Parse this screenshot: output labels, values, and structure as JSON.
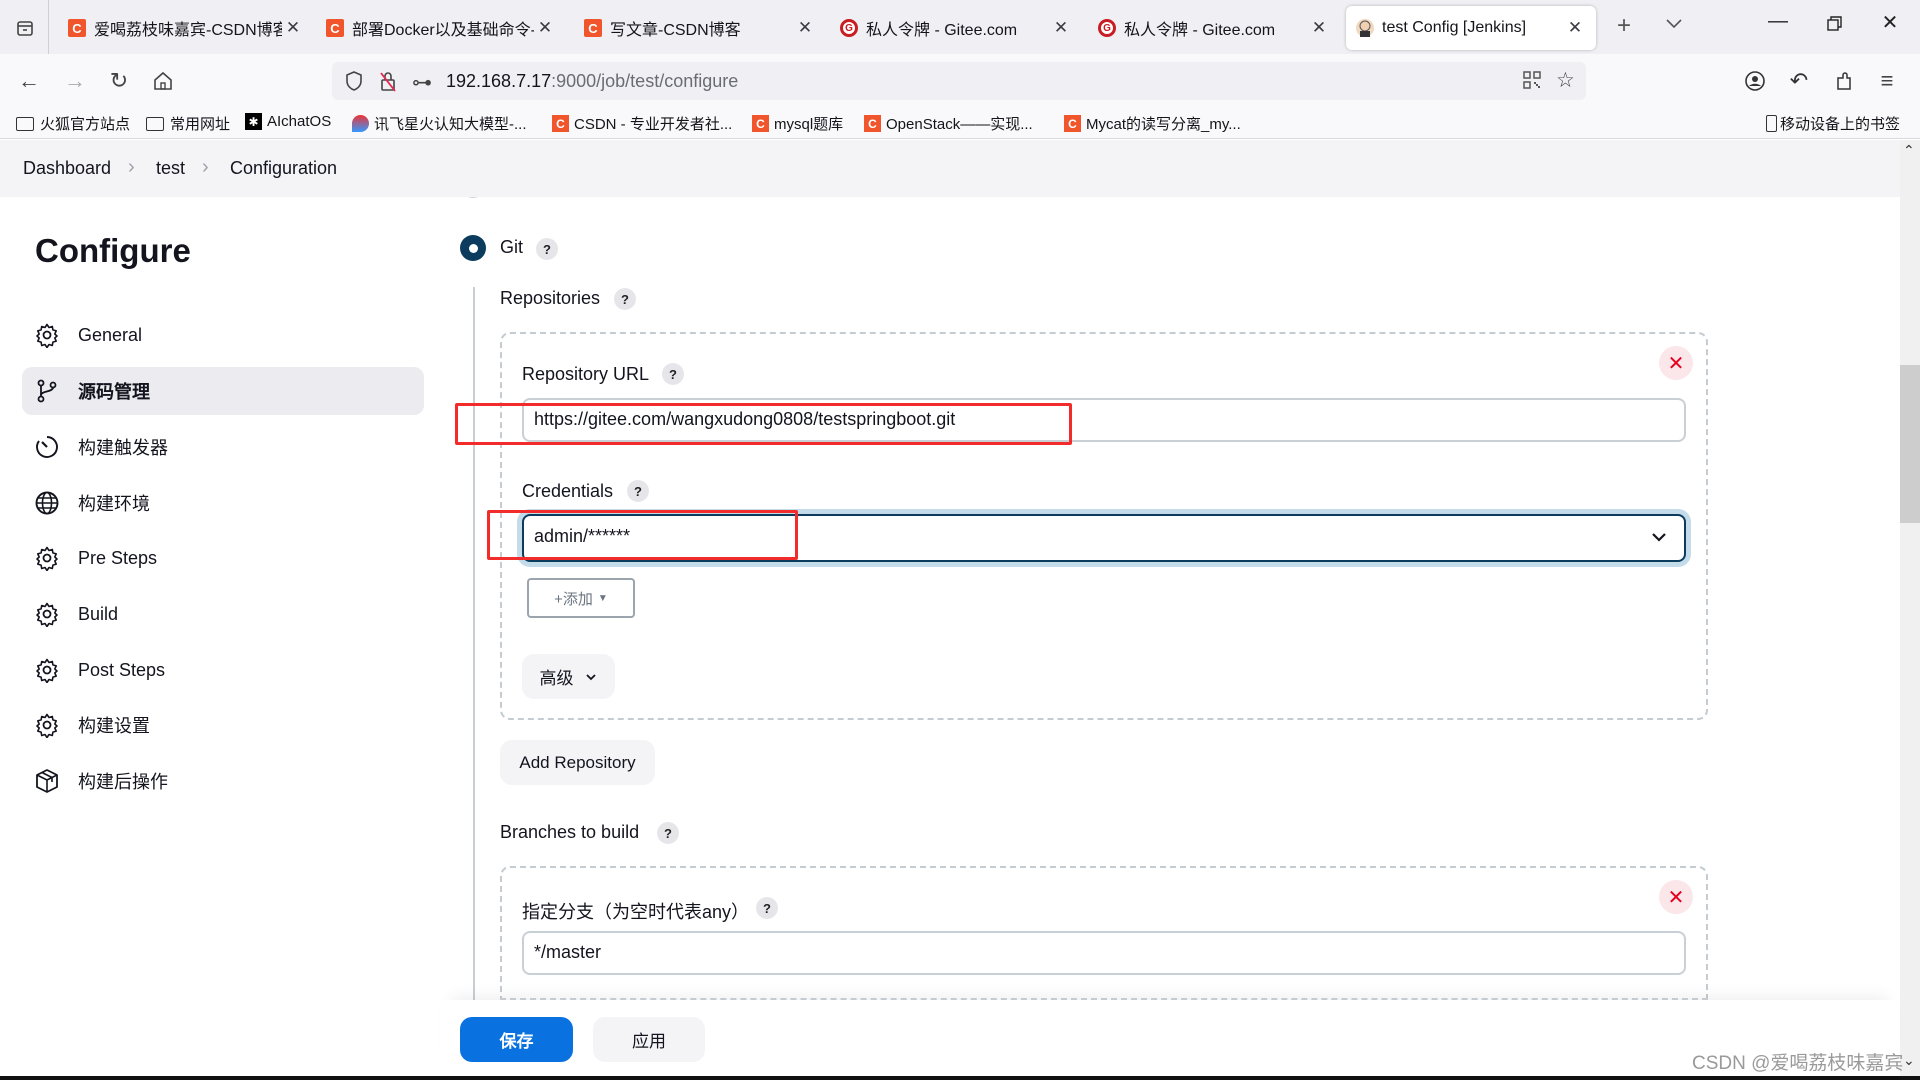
{
  "browser": {
    "tabs": [
      {
        "title": "爱喝荔枝味嘉宾-CSDN博客",
        "icon": "csdn-icon",
        "active": false
      },
      {
        "title": "部署Docker以及基础命令-CSDN",
        "icon": "csdn-icon",
        "active": false
      },
      {
        "title": "写文章-CSDN博客",
        "icon": "csdn-icon",
        "active": false
      },
      {
        "title": "私人令牌 - Gitee.com",
        "icon": "gitee-icon",
        "active": false
      },
      {
        "title": "私人令牌 - Gitee.com",
        "icon": "gitee-icon",
        "active": false
      },
      {
        "title": "test Config [Jenkins]",
        "icon": "jenkins-icon",
        "active": true
      }
    ],
    "url_host": "192.168.7.17",
    "url_rest": ":9000/job/test/configure",
    "bookmarks": [
      {
        "label": "火狐官方站点",
        "icon": "folder-icon"
      },
      {
        "label": "常用网址",
        "icon": "folder-icon"
      },
      {
        "label": "AIchatOS",
        "icon": "openai-icon"
      },
      {
        "label": "讯飞星火认知大模型-...",
        "icon": "spark-icon"
      },
      {
        "label": "CSDN - 专业开发者社...",
        "icon": "csdn-icon"
      },
      {
        "label": "mysql题库",
        "icon": "csdn-icon"
      },
      {
        "label": "OpenStack——实现...",
        "icon": "csdn-icon"
      },
      {
        "label": "Mycat的读写分离_my...",
        "icon": "csdn-icon"
      }
    ],
    "mobile_bookmarks": "移动设备上的书签"
  },
  "breadcrumb": [
    "Dashboard",
    "test",
    "Configuration"
  ],
  "sidebar": {
    "title": "Configure",
    "items": [
      {
        "label": "General",
        "icon": "gear-icon",
        "active": false
      },
      {
        "label": "源码管理",
        "icon": "branch-icon",
        "active": true
      },
      {
        "label": "构建触发器",
        "icon": "timer-icon",
        "active": false
      },
      {
        "label": "构建环境",
        "icon": "globe-icon",
        "active": false
      },
      {
        "label": "Pre Steps",
        "icon": "gear-icon",
        "active": false
      },
      {
        "label": "Build",
        "icon": "gear-icon",
        "active": false
      },
      {
        "label": "Post Steps",
        "icon": "gear-icon",
        "active": false
      },
      {
        "label": "构建设置",
        "icon": "gear-icon",
        "active": false
      },
      {
        "label": "构建后操作",
        "icon": "package-icon",
        "active": false
      }
    ]
  },
  "scm": {
    "git_label": "Git",
    "repositories_label": "Repositories",
    "repo_url_label": "Repository URL",
    "repo_url_value": "https://gitee.com/wangxudong0808/testspringboot.git",
    "credentials_label": "Credentials",
    "credentials_value": "admin/******",
    "add_label": "+添加",
    "advanced_label": "高级",
    "add_repository_label": "Add Repository",
    "branches_label": "Branches to build",
    "branch_specifier_label": "指定分支（为空时代表any）",
    "branch_value": "*/master",
    "help": "?"
  },
  "actions": {
    "save": "保存",
    "apply": "应用"
  },
  "watermark": "CSDN @爱喝荔枝味嘉宾"
}
